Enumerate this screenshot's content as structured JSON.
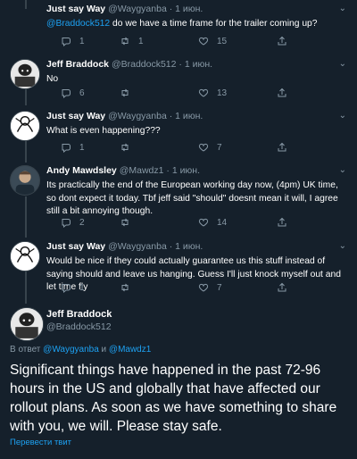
{
  "icons": {
    "reply": "reply-icon",
    "retweet": "retweet-icon",
    "like": "like-icon",
    "share": "share-icon",
    "caret": "chevron-down-icon"
  },
  "colors": {
    "background": "#15202b",
    "accent": "#1da1f2",
    "muted": "#8899a6",
    "divider": "#38444d"
  },
  "tweets": [
    {
      "name": "Just say Way",
      "handle": "@Waygyanba",
      "sep": "·",
      "date": "1 июн.",
      "mention": "@Braddock512",
      "text": " do we have a time frame for the trailer coming up?",
      "replies": "1",
      "retweets": "1",
      "likes": "15"
    },
    {
      "name": "Jeff Braddock",
      "handle": "@Braddock512",
      "sep": "·",
      "date": "1 июн.",
      "text": "No",
      "replies": "6",
      "retweets": "",
      "likes": "13"
    },
    {
      "name": "Just say Way",
      "handle": "@Waygyanba",
      "sep": "·",
      "date": "1 июн.",
      "text": "What is even happening???",
      "replies": "1",
      "retweets": "",
      "likes": "7"
    },
    {
      "name": "Andy Mawdsley",
      "handle": "@Mawdz1",
      "sep": "·",
      "date": "1 июн.",
      "text": "Its practically the end of the European working day now, (4pm) UK time, so dont expect it today. Tbf jeff said \"should\" doesnt mean it will, I agree still a bit annoying though.",
      "replies": "2",
      "retweets": "",
      "likes": "14"
    },
    {
      "name": "Just say Way",
      "handle": "@Waygyanba",
      "sep": "·",
      "date": "1 июн.",
      "text": "Would be nice if they could actually guarantee us this stuff instead of saying should and leave us hanging. Guess I'll just knock myself out and let time fly",
      "replies": "1",
      "retweets": "",
      "likes": "7"
    }
  ],
  "main_tweet": {
    "name": "Jeff Braddock",
    "handle": "@Braddock512",
    "reply_prefix": "В ответ ",
    "reply_mention_1": "@Waygyanba",
    "reply_and": " и ",
    "reply_mention_2": "@Mawdz1",
    "text": "Significant things have happened in the past 72-96 hours in the US and globally that have affected our rollout plans. As soon as we have something to share with you, we will. Please stay safe.",
    "translate_label": "Перевести твит"
  }
}
